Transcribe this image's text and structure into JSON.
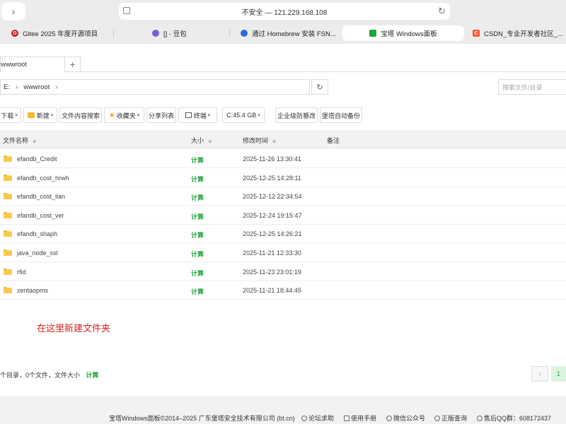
{
  "browser": {
    "url": "不安全 — 121.229.168.108",
    "tabs": [
      {
        "title": "Gitee 2025 年度开源项目",
        "color": "#c71d23",
        "glyph": "G"
      },
      {
        "title": "[] - 豆包",
        "color": "#7a5bd8",
        "glyph": ""
      },
      {
        "title": "通过 Homebrew 安装 FSN...",
        "color": "#2f6bd8",
        "glyph": ""
      },
      {
        "title": "宝塔 Windows面板",
        "color": "#20a53a",
        "glyph": ""
      },
      {
        "title": "CSDN_专业开发者社区_...",
        "color": "#fc5531",
        "glyph": "C"
      }
    ]
  },
  "file_tab": {
    "label": "wwwroot",
    "add_label": "+"
  },
  "path": {
    "drive": "E:",
    "folder": "wwwroot"
  },
  "search": {
    "placeholder": "搜索文件/目录"
  },
  "toolbar": {
    "download": "下载",
    "new": "新建",
    "content_search": "文件内容搜索",
    "favorites": "收藏夹",
    "share_list": "分享列表",
    "terminal": "终端",
    "disk": "C:45.4 GB",
    "tamper": "企业级防篡改",
    "auto_backup": "堡塔自动备份"
  },
  "table": {
    "headers": {
      "name": "文件名称",
      "size": "大小",
      "modified": "修改时间",
      "note": "备注"
    },
    "rows": [
      {
        "name": "efandb_Credit",
        "size": "计算",
        "modified": "2025-11-26 13:30:41"
      },
      {
        "name": "efandb_cost_hrwh",
        "size": "计算",
        "modified": "2025-12-25 14:28:11"
      },
      {
        "name": "efandb_cost_lian",
        "size": "计算",
        "modified": "2025-12-12 22:34:54"
      },
      {
        "name": "efandb_cost_ver",
        "size": "计算",
        "modified": "2025-12-24 19:15:47"
      },
      {
        "name": "efandb_shaph",
        "size": "计算",
        "modified": "2025-12-25 14:26:21"
      },
      {
        "name": "java_node_ssl",
        "size": "计算",
        "modified": "2025-11-21 12:33:30"
      },
      {
        "name": "rfid",
        "size": "计算",
        "modified": "2025-11-23 23:01:19"
      },
      {
        "name": "zentaopms",
        "size": "计算",
        "modified": "2025-11-21 18:44:45"
      }
    ]
  },
  "annotation": "在这里新建文件夹",
  "summary": {
    "text": "个目录，0个文件，文件大小",
    "calc": "计算"
  },
  "pager": {
    "prev": "‹",
    "current": "1"
  },
  "footer": {
    "copyright": "宝塔Windows面板©2014–2025 广东堡塔安全技术有限公司 (bt.cn)",
    "links": [
      "论坛求助",
      "使用手册",
      "微信公众号",
      "正版查询",
      "售后QQ群：608172437"
    ]
  }
}
